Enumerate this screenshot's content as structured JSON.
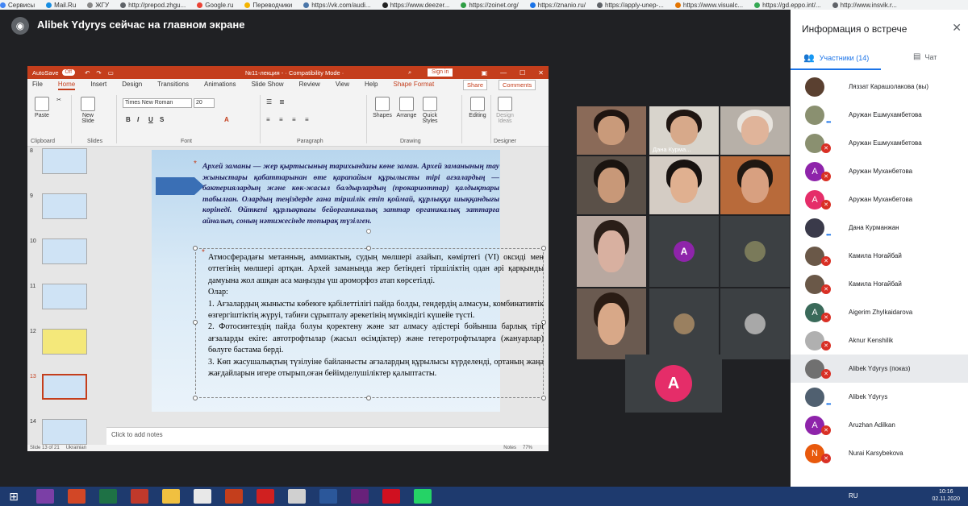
{
  "bookmarks": [
    {
      "label": "Сервисы",
      "color": "#4285f4"
    },
    {
      "label": "Mail.Ru",
      "color": "#168de2"
    },
    {
      "label": "ЖГУ",
      "color": "#888888"
    },
    {
      "label": "http://prepod.zhgu...",
      "color": "#5f6368"
    },
    {
      "label": "Google.ru",
      "color": "#ea4335"
    },
    {
      "label": "Переводчики",
      "color": "#f4b400"
    },
    {
      "label": "https://vk.com/audi...",
      "color": "#4a76a8"
    },
    {
      "label": "https://www.deezer...",
      "color": "#222222"
    },
    {
      "label": "https://zoinet.org/",
      "color": "#2f9e44"
    },
    {
      "label": "https://znanio.ru/",
      "color": "#1a73e8"
    },
    {
      "label": "https://apply-unep-...",
      "color": "#5f6368"
    },
    {
      "label": "https://www.visualc...",
      "color": "#e37400"
    },
    {
      "label": "https://gd.eppo.int/...",
      "color": "#34a853"
    },
    {
      "label": "http://www.insvik.r...",
      "color": "#5f6368"
    }
  ],
  "meet": {
    "presenting_text": "Alibek Ydyrys сейчас на главном экране"
  },
  "ppt": {
    "autosave": "AutoSave",
    "autosave_state": "Off",
    "doc_title": "№11-лекция - · Compatibility Mode ·",
    "signin": "Sign in",
    "tabs": [
      "File",
      "Home",
      "Insert",
      "Design",
      "Transitions",
      "Animations",
      "Slide Show",
      "Review",
      "View",
      "Help",
      "Shape Format"
    ],
    "share": "Share",
    "comments": "Comments",
    "ribbon": {
      "paste": "Paste",
      "new_slide": "New Slide",
      "font_name": "Times New Roman",
      "font_size": "20",
      "shapes": "Shapes",
      "arrange": "Arrange",
      "quick_styles": "Quick Styles",
      "editing": "Editing",
      "design_ideas": "Design Ideas",
      "groups": {
        "clipboard": "Clipboard",
        "slides": "Slides",
        "font": "Font",
        "paragraph": "Paragraph",
        "drawing": "Drawing",
        "designer": "Designer"
      }
    },
    "thumb_numbers": [
      "8",
      "9",
      "10",
      "11",
      "12",
      "13",
      "14"
    ],
    "slide_para1": "Архей заманы — жер қыртысының тарихындағы көне заман. Архей заманының тау жыныстары қабаттарынан өте қарапайым құрылысты тірі ағзалардың — бактериялардың және көк-жасыл балдырлардың (прокариоттар) қалдықтары табылған. Олардың теңіздерде ғана тіршілік етіп қоймай, құрлыққа шыққандығы көрінеді. Өйткені құрлықтағы бейорганикалық заттар органикалық заттарға айналып, соның нәтижесінде топырақ түзілген.",
    "slide_para2_lines": [
      "Атмосферадағы метанның, аммиактың, судың мөлшері азайып, көміртегі (VI) оксиді мен оттегінің мөлшері артқан. Архей заманында жер бетіндегі тіршіліктің одан әрі қарқынды дамуына жол ашқан аса маңызды үш ароморфоз атап көрсетілді.",
      "Олар:",
      "1. Ағзалардың жынысты көбеюге қабілеттілігі пайда болды, гендердің алмасуы, комбинативтік өзгергіштіктің жүруі, табиғи сұрыпталу әрекетінің мүмкіндігі күшейе түсті.",
      "2. Фотосинтездің пайда болуы қоректену және зат алмасу әдістері бойынша барлық тірі ағзаларды екіге: автотрофтылар (жасыл өсімдіктер) және гетеротрофтыларға (жануарлар) бөлуге бастама берді.",
      "3. Көп жасушалықтың түзілуіне байланысты ағзалардың құрылысы күрделенді, ортаның жаңа жағдайларын игере отырып,оған бейімделушіліктер қалыптасты."
    ],
    "notes_placeholder": "Click to add notes",
    "status_slide": "Slide 13 of 21",
    "status_lang": "Ukrainian",
    "status_notes": "Notes",
    "status_zoom": "77%"
  },
  "tiles": [
    {
      "kind": "video",
      "bg": "#8a6a58",
      "skin": "#c99a7a",
      "hair": "#1e1410",
      "name": ""
    },
    {
      "kind": "video",
      "bg": "#d8d4cc",
      "skin": "#d7a98a",
      "hair": "#201612",
      "name": "Дана Курма..."
    },
    {
      "kind": "video",
      "bg": "#b7b0a8",
      "skin": "#e0b49a",
      "hair": "#e8e4de",
      "name": ""
    },
    {
      "kind": "video",
      "bg": "#5a5048",
      "skin": "#c89878",
      "hair": "#1a1410",
      "name": ""
    },
    {
      "kind": "video",
      "bg": "#d4ccc4",
      "skin": "#e0b090",
      "hair": "#181210",
      "name": ""
    },
    {
      "kind": "video",
      "bg": "#b86a3a",
      "skin": "#d8a080",
      "hair": "#201812",
      "name": ""
    },
    {
      "kind": "video",
      "bg": "#b8a8a0",
      "skin": "#d8b0a0",
      "hair": "#2a1e18",
      "name": ""
    },
    {
      "kind": "avatar",
      "letter": "A",
      "color": "#8e24aa"
    },
    {
      "kind": "photo",
      "color": "#7a7a5a"
    },
    {
      "kind": "video",
      "bg": "#6a5a50",
      "skin": "#d8a888",
      "hair": "#2a1c14",
      "name": ""
    },
    {
      "kind": "photo",
      "color": "#9a8060"
    },
    {
      "kind": "photo",
      "color": "#a8a8a8"
    },
    {
      "kind": "avatar_big",
      "letter": "A",
      "color": "#e52d69"
    }
  ],
  "panel": {
    "title": "Информация о встрече",
    "tab_participants": "Участники (14)",
    "tab_chat": "Чат",
    "participants": [
      {
        "name": "Ляззат Карашолакова (вы)",
        "avatar": "photo",
        "color": "#5a4030",
        "muted": false,
        "dots": false,
        "hl": false
      },
      {
        "name": "Аружан Ешмухамбетова",
        "avatar": "photo",
        "color": "#8a9070",
        "muted": false,
        "dots": true,
        "hl": false
      },
      {
        "name": "Аружан Ешмухамбетова",
        "avatar": "photo",
        "color": "#8a9070",
        "muted": true,
        "dots": false,
        "hl": false
      },
      {
        "name": "Аружан Муханбетова",
        "avatar": "letter",
        "letter": "А",
        "color": "#8e24aa",
        "muted": true,
        "dots": false,
        "hl": false
      },
      {
        "name": "Аружан Муханбетова",
        "avatar": "letter",
        "letter": "А",
        "color": "#e52d69",
        "muted": true,
        "dots": false,
        "hl": false
      },
      {
        "name": "Дана Курманжан",
        "avatar": "photo",
        "color": "#3a3a4a",
        "muted": false,
        "dots": true,
        "hl": false
      },
      {
        "name": "Камила Ноғайбай",
        "avatar": "photo",
        "color": "#6a5848",
        "muted": true,
        "dots": false,
        "hl": false
      },
      {
        "name": "Камила Ноғайбай",
        "avatar": "photo",
        "color": "#6a5848",
        "muted": true,
        "dots": false,
        "hl": false
      },
      {
        "name": "Aigerim Zhylkaidarova",
        "avatar": "letter",
        "letter": "A",
        "color": "#3a6a5a",
        "muted": true,
        "dots": false,
        "hl": false
      },
      {
        "name": "Aknur Kenshilik",
        "avatar": "photo",
        "color": "#b0b0b0",
        "muted": true,
        "dots": false,
        "hl": false
      },
      {
        "name": "Alibek Ydyrys (показ)",
        "avatar": "photo",
        "color": "#707070",
        "muted": true,
        "dots": false,
        "hl": true
      },
      {
        "name": "Alibek Ydyrys",
        "avatar": "photo",
        "color": "#506070",
        "muted": false,
        "dots": true,
        "hl": false
      },
      {
        "name": "Aruzhan Adilkan",
        "avatar": "letter",
        "letter": "A",
        "color": "#8e24aa",
        "muted": true,
        "dots": false,
        "hl": false
      },
      {
        "name": "Nurai Karsybekova",
        "avatar": "letter",
        "letter": "N",
        "color": "#e8590c",
        "muted": true,
        "dots": false,
        "hl": false
      }
    ]
  },
  "taskbar": {
    "apps": [
      {
        "name": "start",
        "color": "#1e3a6e"
      },
      {
        "name": "onenote-app",
        "color": "#7b3fa6"
      },
      {
        "name": "powerpoint-app",
        "color": "#d24726"
      },
      {
        "name": "excel-app",
        "color": "#1e7145"
      },
      {
        "name": "pdf-app",
        "color": "#c0392b"
      },
      {
        "name": "explorer-app",
        "color": "#f0c040"
      },
      {
        "name": "chrome-app",
        "color": "#e8e8e8"
      },
      {
        "name": "powerpoint-app-2",
        "color": "#c43e1c"
      },
      {
        "name": "yandex-app",
        "color": "#d02020"
      },
      {
        "name": "viewer-app",
        "color": "#d0d0d0"
      },
      {
        "name": "word-app",
        "color": "#2b579a"
      },
      {
        "name": "vs-app",
        "color": "#68217a"
      },
      {
        "name": "opera-app",
        "color": "#d01020"
      },
      {
        "name": "whatsapp-app",
        "color": "#25d366"
      }
    ],
    "lang": "RU",
    "time": "10:16",
    "date": "02.11.2020"
  }
}
